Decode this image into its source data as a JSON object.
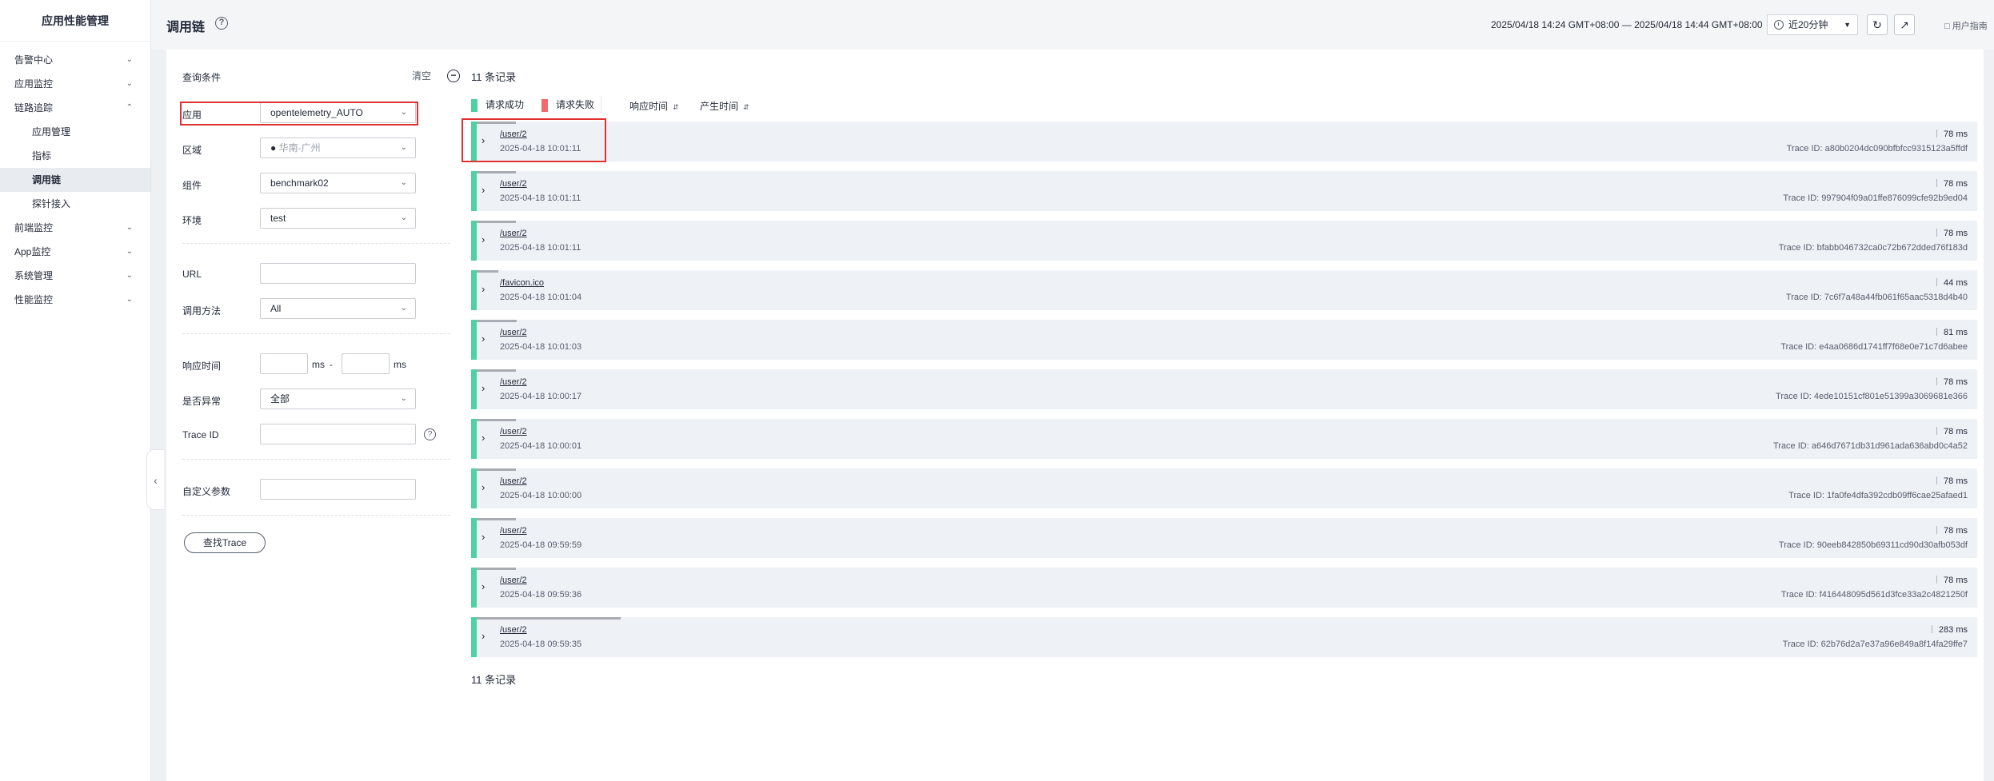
{
  "nav": {
    "title": "应用性能管理",
    "items": [
      {
        "label": "告警中心"
      },
      {
        "label": "应用监控"
      },
      {
        "label": "链路追踪"
      }
    ],
    "sub_items": [
      {
        "label": "应用管理"
      },
      {
        "label": "指标"
      },
      {
        "label": "调用链"
      },
      {
        "label": "探针接入"
      }
    ],
    "items_after": [
      {
        "label": "前端监控"
      },
      {
        "label": "App监控"
      },
      {
        "label": "系统管理"
      },
      {
        "label": "性能监控"
      }
    ]
  },
  "header": {
    "title": "调用链",
    "time_range": "2025/04/18 14:24 GMT+08:00 — 2025/04/18 14:44 GMT+08:00",
    "time_select": "近20分钟",
    "guide": "用户指南"
  },
  "query": {
    "title": "查询条件",
    "clear": "清空",
    "app_label": "应用",
    "app_value": "opentelemetry_AUTO",
    "region_label": "区域",
    "region_value": "华南-广州",
    "component_label": "组件",
    "component_value": "benchmark02",
    "env_label": "环境",
    "env_value": "test",
    "url_label": "URL",
    "url_value": "",
    "method_label": "调用方法",
    "method_value": "All",
    "resp_label": "响应时间",
    "ms_unit": "ms",
    "dash": "-",
    "error_label": "是否异常",
    "error_value": "全部",
    "traceid_label": "Trace ID",
    "custom_label": "自定义参数",
    "find_button": "查找Trace"
  },
  "results": {
    "count_label": "11 条记录",
    "legend_success": "请求成功",
    "legend_fail": "请求失败",
    "sort_resp": "响应时间",
    "sort_time": "产生时间",
    "colors": {
      "success": "#4fd1a2",
      "fail": "#f26b6b"
    },
    "rows": [
      {
        "path": "/user/2",
        "time": "2025-04-18 10:01:11",
        "duration": "78 ms",
        "trace_id": "Trace ID:  a80b0204dc090bfbfcc9315123a5ffdf",
        "span_frac": 0.27
      },
      {
        "path": "/user/2",
        "time": "2025-04-18 10:01:11",
        "duration": "78 ms",
        "trace_id": "Trace ID:  997904f09a01ffe876099cfe92b9ed04",
        "span_frac": 0.27
      },
      {
        "path": "/user/2",
        "time": "2025-04-18 10:01:11",
        "duration": "78 ms",
        "trace_id": "Trace ID:  bfabb046732ca0c72b672dded76f183d",
        "span_frac": 0.27
      },
      {
        "path": "/favicon.ico",
        "time": "2025-04-18 10:01:04",
        "duration": "44 ms",
        "trace_id": "Trace ID:  7c6f7a48a44fb061f65aac5318d4b40",
        "span_frac": 0.15
      },
      {
        "path": "/user/2",
        "time": "2025-04-18 10:01:03",
        "duration": "81 ms",
        "trace_id": "Trace ID:  e4aa0686d1741ff7f68e0e71c7d6abee",
        "span_frac": 0.28
      },
      {
        "path": "/user/2",
        "time": "2025-04-18 10:00:17",
        "duration": "78 ms",
        "trace_id": "Trace ID:  4ede10151cf801e51399a3069681e366",
        "span_frac": 0.27
      },
      {
        "path": "/user/2",
        "time": "2025-04-18 10:00:01",
        "duration": "78 ms",
        "trace_id": "Trace ID:  a646d7671db31d961ada636abd0c4a52",
        "span_frac": 0.27
      },
      {
        "path": "/user/2",
        "time": "2025-04-18 10:00:00",
        "duration": "78 ms",
        "trace_id": "Trace ID:  1fa0fe4dfa392cdb09ff6cae25afaed1",
        "span_frac": 0.27
      },
      {
        "path": "/user/2",
        "time": "2025-04-18 09:59:59",
        "duration": "78 ms",
        "trace_id": "Trace ID:  90eeb842850b69311cd90d30afb053df",
        "span_frac": 0.27
      },
      {
        "path": "/user/2",
        "time": "2025-04-18 09:59:36",
        "duration": "78 ms",
        "trace_id": "Trace ID:  f416448095d561d3fce33a2c4821250f",
        "span_frac": 0.27
      },
      {
        "path": "/user/2",
        "time": "2025-04-18 09:59:35",
        "duration": "283 ms",
        "trace_id": "Trace ID:  62b76d2a7e37a96e849a8f14fa29ffe7",
        "span_frac": 1.0
      }
    ]
  }
}
